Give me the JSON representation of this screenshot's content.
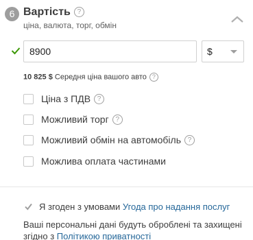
{
  "section": {
    "step_number": "6",
    "title": "Вартість",
    "help_glyph": "?",
    "subtitle": "ціна, валюта, торг, обмін",
    "collapse_icon": "chevron-up-icon"
  },
  "price": {
    "value": "8900",
    "valid_icon": "checkmark-icon",
    "valid_color": "#3c9806"
  },
  "currency": {
    "selected": "$",
    "caret_icon": "caret-down-icon"
  },
  "average": {
    "amount": "10 825 $",
    "label": "Середня ціна вашого авто"
  },
  "options": [
    {
      "label": "Ціна з ПДВ",
      "has_help": true,
      "checked": false
    },
    {
      "label": "Можливий торг",
      "has_help": true,
      "checked": false
    },
    {
      "label": "Можливий обмін на автомобіль",
      "has_help": true,
      "checked": false
    },
    {
      "label": "Можлива оплата частинами",
      "has_help": false,
      "checked": false
    }
  ],
  "agreement": {
    "text": "Я згоден з умовами",
    "link": "Угода про надання послуг",
    "checked": true
  },
  "privacy": {
    "text": "Ваші персональні дані будуть оброблені та захищені згідно з",
    "link": "Політикою приватності"
  },
  "colors": {
    "link": "#256799",
    "badge": "#9e9e9e"
  }
}
